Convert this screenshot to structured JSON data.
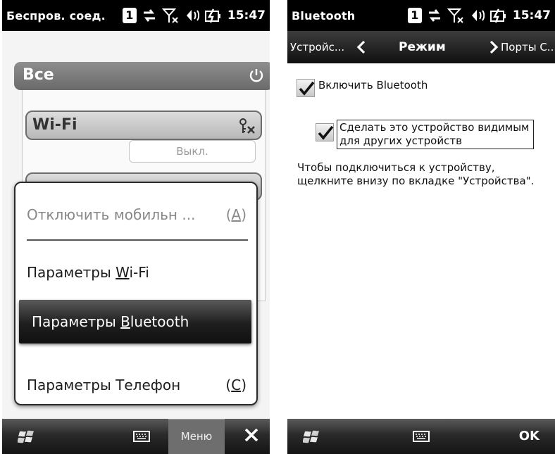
{
  "left_screen": {
    "status_title": "Беспров. соед.",
    "sim_number": "1",
    "time": "15:47",
    "all_section": {
      "label": "Все"
    },
    "wifi_card": {
      "label": "Wi-Fi",
      "toggle_state": "Выкл."
    },
    "context_menu": {
      "items": [
        {
          "name": "disable-mobile",
          "label": "Отключить мобильн",
          "ellipsis": " ...",
          "shortcut": "(A)",
          "enabled": false
        },
        {
          "name": "wifi-settings",
          "label_prefix": "Параметры ",
          "label_accel": "W",
          "label_rest": "i-Fi",
          "enabled": true
        },
        {
          "name": "bluetooth-settings",
          "label_prefix": "Параметры ",
          "label_accel": "B",
          "label_rest": "luetooth",
          "enabled": true,
          "selected": true
        },
        {
          "name": "phone-settings",
          "label": "Параметры Телефон",
          "shortcut_open": "(",
          "shortcut_accel": "C",
          "shortcut_close": ")",
          "enabled": true
        }
      ]
    },
    "bottom_bar": {
      "menu_label": "Меню"
    }
  },
  "right_screen": {
    "status_title": "Bluetooth",
    "sim_number": "1",
    "time": "15:47",
    "tabs": {
      "prev": "Устройс...",
      "current": "Режим",
      "next": "Порты С..."
    },
    "checkboxes": [
      {
        "label": "Включить Bluetooth",
        "checked": true
      },
      {
        "label_line1": "Сделать это устройство видимым",
        "label_line2": "для других устройств",
        "checked": true
      }
    ],
    "info_text_line1": "Чтобы подключиться к устройству,",
    "info_text_line2": "щелкните внизу по вкладке \"Устройства\".",
    "bottom_bar": {
      "ok_label": "OK"
    }
  },
  "icons": {
    "status": [
      "sim-icon",
      "data-transfer-icon",
      "no-signal-icon",
      "volume-icon",
      "battery-charging-icon"
    ],
    "bottom": [
      "windows-start-icon",
      "keyboard-icon",
      "close-icon"
    ]
  },
  "colors": {
    "status_bar": "#000000",
    "header_gray": "#7a7a7a",
    "selected_item": "#1e1e1e",
    "menu_button": "#6e6e6e"
  }
}
